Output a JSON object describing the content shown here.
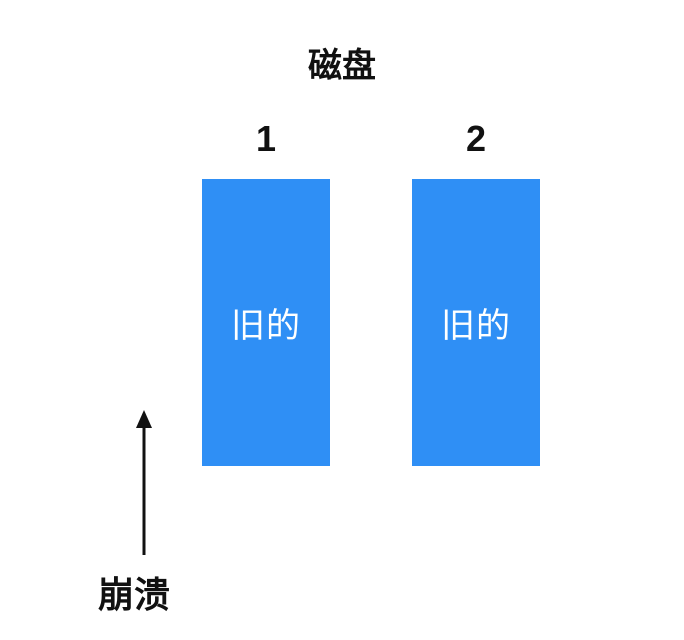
{
  "title": "磁盘",
  "disks": [
    {
      "number": "1",
      "content": "旧的",
      "color": "#2f8ff5"
    },
    {
      "number": "2",
      "content": "旧的",
      "color": "#2f8ff5"
    }
  ],
  "crash": {
    "label": "崩溃"
  }
}
